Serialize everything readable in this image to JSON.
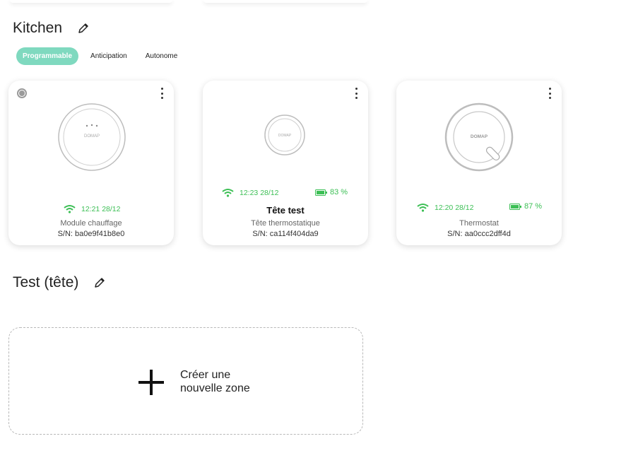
{
  "zones": [
    {
      "title": "Kitchen",
      "modes": [
        "Programmable",
        "Anticipation",
        "Autonome"
      ],
      "active_mode": "Programmable",
      "devices": [
        {
          "name": "",
          "type": "Module chauffage",
          "sn": "S/N: ba0e9f41b8e0",
          "time": "12:21 28/12",
          "battery": null,
          "selectable": true,
          "icon": "module-chauffage-image"
        },
        {
          "name": "Tête test",
          "type": "Tête thermostatique",
          "sn": "S/N: ca114f404da9",
          "time": "12:23 28/12",
          "battery": "83 %",
          "battery_level": 0.83,
          "icon": "tete-thermostatique-image"
        },
        {
          "name": "",
          "type": "Thermostat",
          "sn": "S/N: aa0ccc2dff4d",
          "time": "12:20 28/12",
          "battery": "87 %",
          "battery_level": 0.87,
          "icon": "thermostat-image"
        }
      ]
    },
    {
      "title": "Test (tête)"
    }
  ],
  "create_zone": {
    "line1": "Créer une",
    "line2": "nouvelle zone"
  },
  "brand_text": "DOMAP",
  "colors": {
    "accent": "#7fd9bf",
    "status_green": "#3cbf55"
  }
}
